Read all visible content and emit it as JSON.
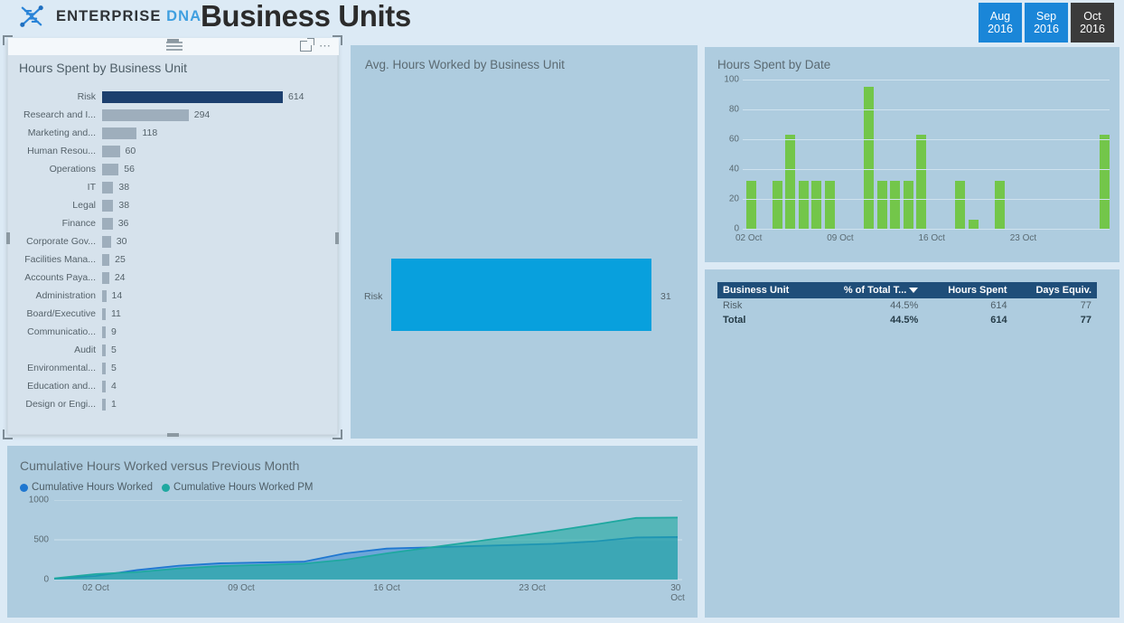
{
  "header": {
    "brand_main": "ENTERPRISE",
    "brand_accent": "DNA",
    "title": "Business Units",
    "logo_icon": "dna-helix-icon",
    "months": [
      {
        "month": "Aug",
        "year": "2016",
        "selected": false
      },
      {
        "month": "Sep",
        "year": "2016",
        "selected": false
      },
      {
        "month": "Oct",
        "year": "2016",
        "selected": true
      }
    ]
  },
  "panels": {
    "hours_by_unit": {
      "title": "Hours Spent by Business Unit",
      "icons": [
        "filter-icon",
        "focus-mode-icon",
        "more-options-icon"
      ]
    },
    "avg_hours": {
      "title": "Avg. Hours Worked by Business Unit",
      "bar_label": "Risk",
      "bar_value": "31"
    },
    "hours_by_date": {
      "title": "Hours Spent by Date"
    },
    "cumulative": {
      "title": "Cumulative Hours Worked versus Previous Month"
    }
  },
  "table": {
    "columns": [
      "Business Unit",
      "% of Total T...",
      "Hours Spent",
      "Days Equiv."
    ],
    "sorted_column_index": 1,
    "rows": [
      {
        "unit": "Risk",
        "pct": "44.5%",
        "hours": "614",
        "days": "77",
        "total": false
      },
      {
        "unit": "Total",
        "pct": "44.5%",
        "hours": "614",
        "days": "77",
        "total": true
      }
    ]
  },
  "colors": {
    "accent_blue": "#1a86d8",
    "selected_dark": "#3b3b3b",
    "bar_selected": "#1c3f6e",
    "bar_default": "#9eaebc",
    "avg_bar": "#08a0dd",
    "green_bar": "#73c64a",
    "table_header": "#1f4e79",
    "panel_bg": "#aeccdf",
    "page_bg": "#dceaf5",
    "series_blue": "#1f77d0",
    "series_teal": "#1fa8a0"
  },
  "chart_data": [
    {
      "type": "bar",
      "title": "Hours Spent by Business Unit",
      "orientation": "horizontal",
      "xlabel": "",
      "ylabel": "",
      "highlight_category": "Risk",
      "categories": [
        "Risk",
        "Research and I...",
        "Marketing and...",
        "Human Resou...",
        "Operations",
        "IT",
        "Legal",
        "Finance",
        "Corporate Gov...",
        "Facilities Mana...",
        "Accounts Paya...",
        "Administration",
        "Board/Executive",
        "Communicatio...",
        "Audit",
        "Environmental...",
        "Education and...",
        "Design or Engi..."
      ],
      "values": [
        614,
        294,
        118,
        60,
        56,
        38,
        38,
        36,
        30,
        25,
        24,
        14,
        11,
        9,
        5,
        5,
        4,
        1
      ],
      "data_labels": true
    },
    {
      "type": "bar",
      "title": "Avg. Hours Worked by Business Unit",
      "orientation": "horizontal",
      "categories": [
        "Risk"
      ],
      "values": [
        31
      ],
      "data_labels": true
    },
    {
      "type": "bar",
      "title": "Hours Spent by Date",
      "orientation": "vertical",
      "xlabel": "",
      "ylabel": "",
      "ylim": [
        0,
        100
      ],
      "yticks": [
        0,
        20,
        40,
        60,
        80,
        100
      ],
      "grid": true,
      "xticks_labeled": [
        "02 Oct",
        "09 Oct",
        "16 Oct",
        "23 Oct"
      ],
      "categories": [
        "02 Oct",
        "03 Oct",
        "04 Oct",
        "05 Oct",
        "06 Oct",
        "07 Oct",
        "08 Oct",
        "09 Oct",
        "10 Oct",
        "11 Oct",
        "12 Oct",
        "13 Oct",
        "14 Oct",
        "15 Oct",
        "16 Oct",
        "17 Oct",
        "18 Oct",
        "19 Oct",
        "20 Oct",
        "21 Oct",
        "22 Oct",
        "23 Oct",
        "24 Oct",
        "25 Oct",
        "26 Oct",
        "27 Oct",
        "28 Oct",
        "29 Oct"
      ],
      "values": [
        32,
        0,
        32,
        63,
        32,
        32,
        32,
        0,
        0,
        95,
        32,
        32,
        32,
        63,
        0,
        0,
        32,
        6,
        0,
        32,
        0,
        0,
        0,
        0,
        0,
        0,
        0,
        63
      ]
    },
    {
      "type": "area",
      "title": "Cumulative Hours Worked versus Previous Month",
      "ylim": [
        0,
        1000
      ],
      "yticks": [
        0,
        500,
        1000
      ],
      "grid": true,
      "legend_position": "top-left",
      "xticks_labeled": [
        "02 Oct",
        "09 Oct",
        "16 Oct",
        "23 Oct",
        "30 Oct"
      ],
      "x": [
        "01 Oct",
        "03 Oct",
        "05 Oct",
        "07 Oct",
        "09 Oct",
        "11 Oct",
        "13 Oct",
        "15 Oct",
        "17 Oct",
        "19 Oct",
        "21 Oct",
        "23 Oct",
        "25 Oct",
        "27 Oct",
        "29 Oct",
        "30 Oct"
      ],
      "series": [
        {
          "name": "Cumulative Hours Worked",
          "color": "#1f77d0",
          "values": [
            10,
            45,
            120,
            175,
            205,
            215,
            225,
            330,
            390,
            405,
            420,
            435,
            450,
            480,
            530,
            535
          ]
        },
        {
          "name": "Cumulative Hours Worked PM",
          "color": "#1fa8a0",
          "values": [
            15,
            70,
            95,
            140,
            170,
            185,
            200,
            250,
            330,
            400,
            470,
            540,
            610,
            690,
            775,
            780
          ]
        }
      ]
    }
  ]
}
